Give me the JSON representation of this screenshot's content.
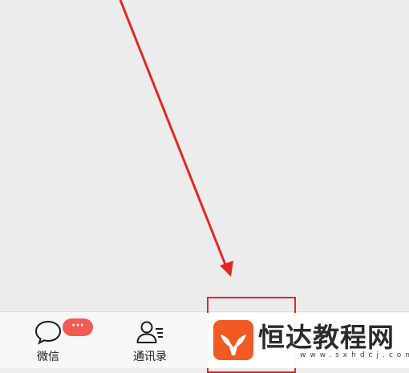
{
  "tabbar": {
    "wechat": {
      "label": "微信",
      "badge": "···"
    },
    "contacts": {
      "label": "通讯录"
    }
  },
  "watermark": {
    "title": "恒达教程网",
    "domain": "www.sxhdcj.com"
  },
  "colors": {
    "annotation": "#e52521",
    "badge": "#f35a53",
    "logo": "#f05a24"
  },
  "icons": [
    "chat-bubble-icon",
    "contacts-icon",
    "whale-logo-icon"
  ]
}
